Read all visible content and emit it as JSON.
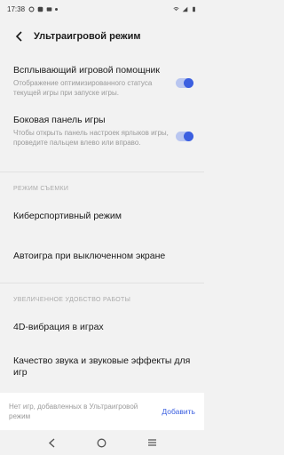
{
  "status_bar": {
    "time": "17:38"
  },
  "header": {
    "title": "Ультраигровой режим"
  },
  "settings": {
    "floating_assistant": {
      "title": "Всплывающий игровой помощник",
      "subtitle": "Отображение оптимизированного статуса текущей игры при запуске игры.",
      "enabled": true
    },
    "side_panel": {
      "title": "Боковая панель игры",
      "subtitle": "Чтобы открыть панель настроек ярлыков игры, проведите пальцем влево или вправо.",
      "enabled": true
    }
  },
  "section_shooting": {
    "label": "РЕЖИМ СЪЕМКИ",
    "items": [
      "Киберспортивный режим",
      "Автоигра при выключенном экране"
    ]
  },
  "section_comfort": {
    "label": "УВЕЛИЧЕННОЕ УДОБСТВО РАБОТЫ",
    "items": [
      "4D-вибрация в играх",
      "Качество звука и звуковые эффекты для игр"
    ]
  },
  "banner": {
    "text": "Нет игр, добавленных в Ультраигровой режим",
    "action": "Добавить"
  },
  "colors": {
    "accent": "#3b5fe0",
    "background": "#f2f2f2"
  }
}
